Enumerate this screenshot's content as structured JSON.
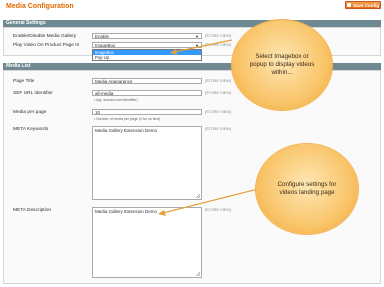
{
  "header": {
    "title": "Media Configuration",
    "save_label": "Save Config"
  },
  "general": {
    "title": "General Settings",
    "enable_label": "Enable/Disable Media Gallery",
    "enable_value": "Enable",
    "play_label": "Play Video On Product Page In",
    "play_value": "ImageBox",
    "options": [
      "ImageBox",
      "Pop Up"
    ],
    "scope": "[STORE VIEW]"
  },
  "media_list": {
    "title": "Media List",
    "page_title_label": "Page Title",
    "page_title_value": "Media Appearance",
    "sef_label": "SEF URL Identifier",
    "sef_value": "all-media",
    "sef_note": "• (eg: domain.com/identifier)",
    "per_page_label": "Media per page",
    "per_page_value": "10",
    "per_page_note": "• Number of media per page (0 for no limit)",
    "meta_keywords_label": "META Keywords",
    "meta_keywords_value": "Media Gallery Extension Demo",
    "meta_description_label": "META Description",
    "meta_description_value": "Media Gallery Extension Demo",
    "scope": "[STORE VIEW]"
  },
  "callouts": {
    "first": "Select Imagebox or popup to display videos within...",
    "second": "Configure settings for videos landing page"
  },
  "colors": {
    "accent": "#e26703",
    "section": "#6f8992",
    "callout": "#f9c56a"
  }
}
